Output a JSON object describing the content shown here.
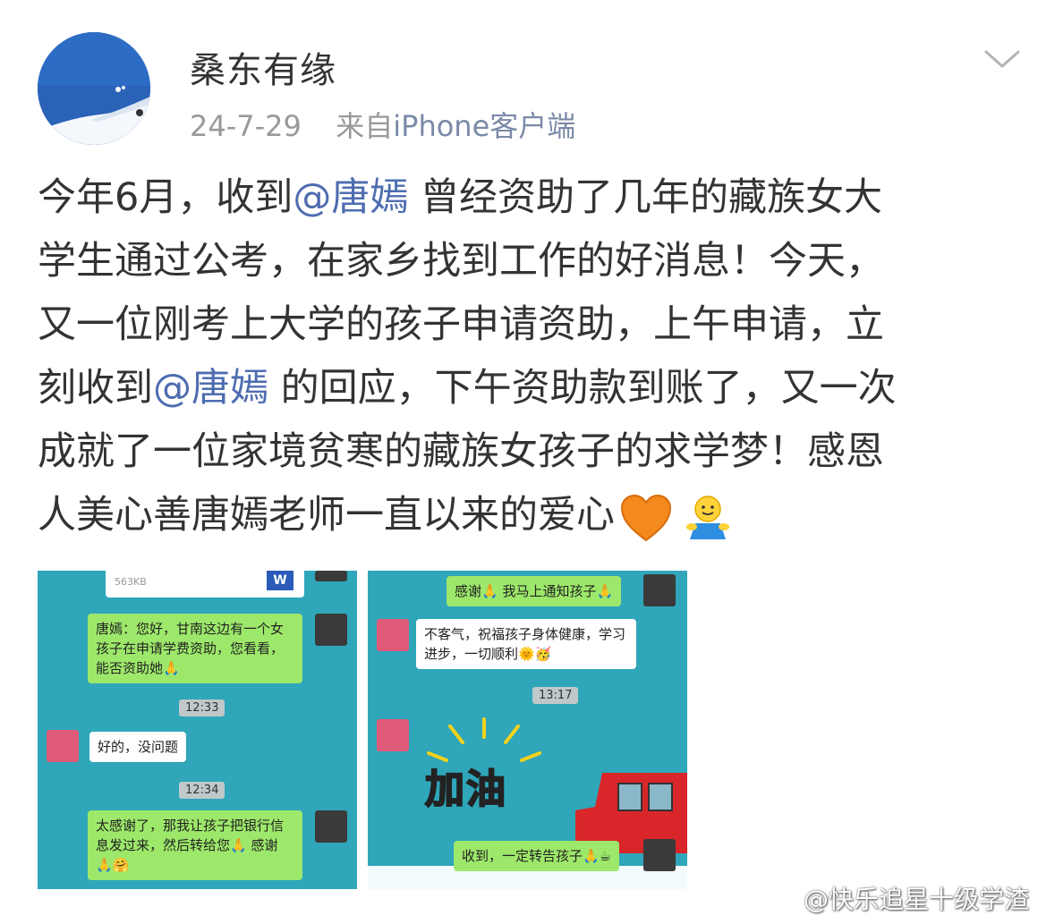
{
  "post": {
    "author": "桑东有缘",
    "date": "24-7-29",
    "source_prefix": "来自",
    "source": "iPhone客户端",
    "text": {
      "l1a": "今年6月，收到",
      "mention1": "@唐嫣",
      "l1b": " 曾经资助了几年的藏族女大",
      "l2": "学生通过公考，在家乡找到工作的好消息！今天，",
      "l3": "又一位刚考上大学的孩子申请资助，上午申请，立",
      "l4a": "刻收到",
      "mention2": "@唐嫣",
      "l4b": " 的回应，下午资助款到账了，又一次",
      "l5": "成就了一位家境贫寒的藏族女孩子的求学梦！感恩",
      "l6": "人美心善唐嫣老师一直以来的爱心"
    },
    "emojis": [
      "orange-heart-icon",
      "hug-icon"
    ]
  },
  "screenshot_left": {
    "file_size": "563KB",
    "file_icon_letter": "W",
    "msg1": "唐嫣：您好，甘南这边有一个女孩子在申请学费资助，您看看，能否资助她🙏",
    "time1": "12:33",
    "msg2": "好的，没问题",
    "time2": "12:34",
    "msg3": "太感谢了，那我让孩子把银行信息发过来，然后转给您🙏 感谢🙏🤗"
  },
  "screenshot_right": {
    "msg1": "感谢🙏 我马上通知孩子🙏",
    "msg2": "不客气，祝福孩子身体健康，学习进步，一切顺利🌞🥳",
    "time1": "13:17",
    "sticker_text": "加油",
    "msg3": "收到，一定转告孩子🙏☕"
  },
  "watermark": "@快乐追星十级学渣",
  "colors": {
    "mention": "#4d6cb0",
    "chat_bg": "#2fa6b9",
    "bubble_green": "#9de86a",
    "meta_gray": "#999999"
  }
}
